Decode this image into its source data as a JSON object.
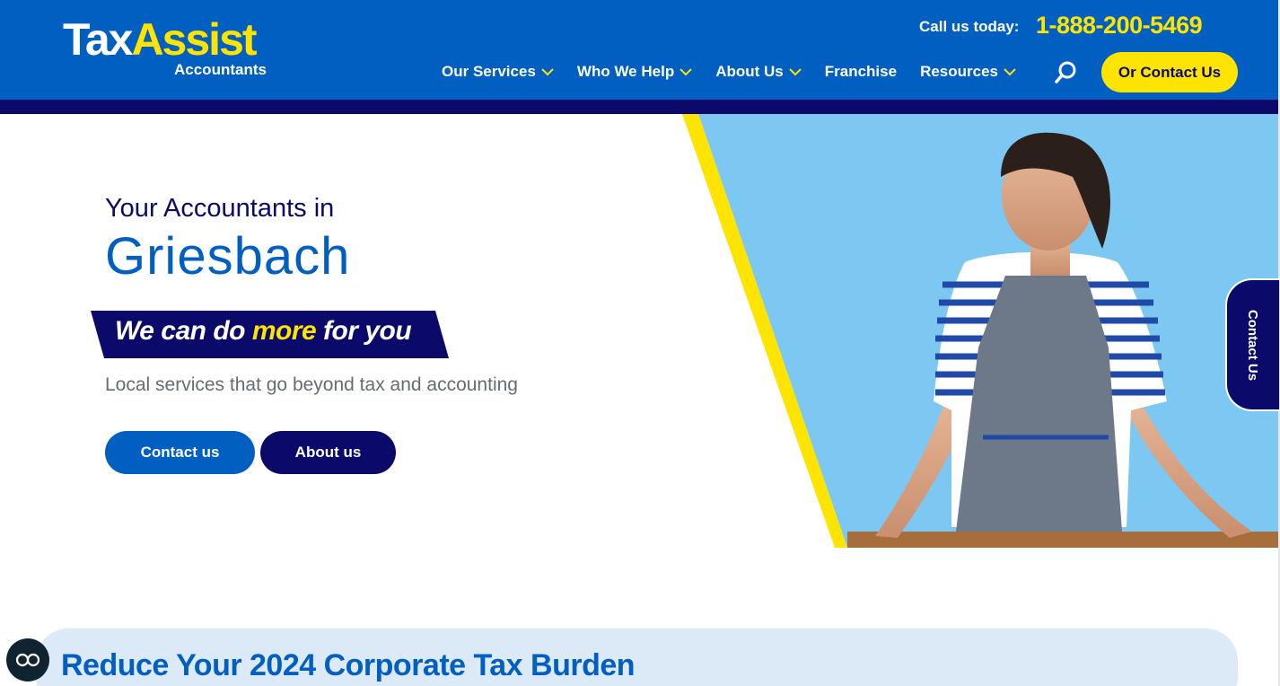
{
  "brand": {
    "logo_main_a": "Tax",
    "logo_main_b": "Assist",
    "logo_sub": "Accountants"
  },
  "header": {
    "call_label": "Call us today:",
    "call_number": "1-888-200-5469",
    "nav": [
      {
        "label": "Our Services",
        "has_dropdown": true
      },
      {
        "label": "Who We Help",
        "has_dropdown": true
      },
      {
        "label": "About Us",
        "has_dropdown": true
      },
      {
        "label": "Franchise",
        "has_dropdown": false
      },
      {
        "label": "Resources",
        "has_dropdown": true
      }
    ],
    "contact_button": "Or Contact Us"
  },
  "hero": {
    "subtitle": "Your Accountants in",
    "city": "Griesbach",
    "banner_before": "We can do ",
    "banner_highlight": "more",
    "banner_after": " for you",
    "tagline": "Local services that go beyond tax and accounting",
    "btn_contact": "Contact us",
    "btn_about": "About us"
  },
  "side_tab": {
    "label": "Contact Us"
  },
  "promo": {
    "title": "Reduce Your 2024 Corporate Tax Burden"
  },
  "colors": {
    "primary_blue": "#005fc0",
    "navy": "#0b0a6b",
    "yellow": "#ffe400",
    "sky": "#7dc8f2"
  },
  "icons": [
    "chevron-down-icon",
    "search-icon",
    "accessibility-icon"
  ]
}
